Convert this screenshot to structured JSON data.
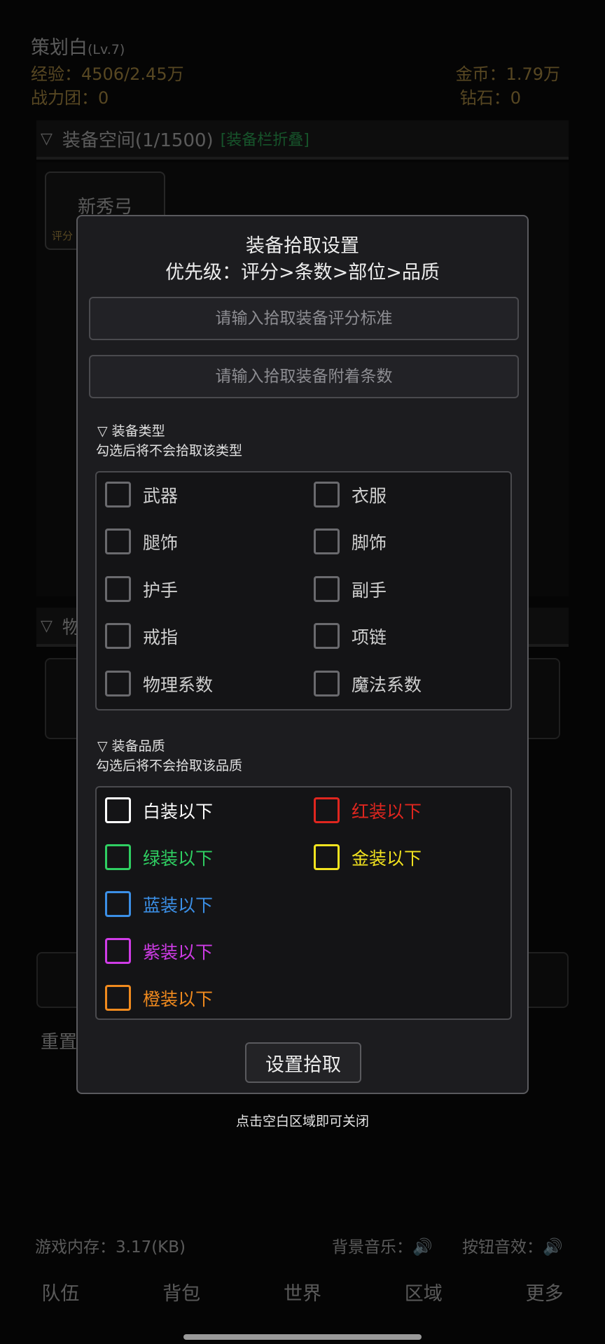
{
  "header": {
    "name": "策划白",
    "level": "(Lv.7)",
    "exp": "经验：4506/2.45万",
    "power": "战力团：0",
    "gold": "金币：1.79万",
    "diamond": "钻石：0"
  },
  "equip_section": {
    "title": "装备空间(1/1500)",
    "fold_link": "[装备栏折叠]",
    "item_name": "新秀弓",
    "item_score": "评分"
  },
  "second_section": {
    "title": "物"
  },
  "reset_label": "重置",
  "modal": {
    "title": "装备拾取设置",
    "subtitle": "优先级：评分>条数>部位>品质",
    "score_placeholder": "请输入拾取装备评分标准",
    "count_placeholder": "请输入拾取装备附着条数",
    "type_head": "▽  装备类型",
    "type_hint": "勾选后将不会拾取该类型",
    "types": [
      "武器",
      "衣服",
      "腿饰",
      "脚饰",
      "护手",
      "副手",
      "戒指",
      "项链",
      "物理系数",
      "魔法系数"
    ],
    "quality_head": "▽  装备品质",
    "quality_hint": "勾选后将不会拾取该品质",
    "qualities": [
      {
        "label": "白装以下",
        "color": "#ffffff"
      },
      {
        "label": "红装以下",
        "color": "#e0261f"
      },
      {
        "label": "绿装以下",
        "color": "#2fcf62"
      },
      {
        "label": "金装以下",
        "color": "#f2e31f"
      },
      {
        "label": "蓝装以下",
        "color": "#3b8fe6"
      },
      {
        "label": "紫装以下",
        "color": "#cf3ce6"
      },
      {
        "label": "橙装以下",
        "color": "#f08a1e"
      }
    ],
    "set_button": "设置拾取"
  },
  "close_hint": "点击空白区域即可关闭",
  "footer": {
    "memory": "游戏内存：3.17(KB)",
    "bgm": "背景音乐：",
    "btn_sound": "按钮音效："
  },
  "nav": [
    "队伍",
    "背包",
    "世界",
    "区域",
    "更多"
  ]
}
